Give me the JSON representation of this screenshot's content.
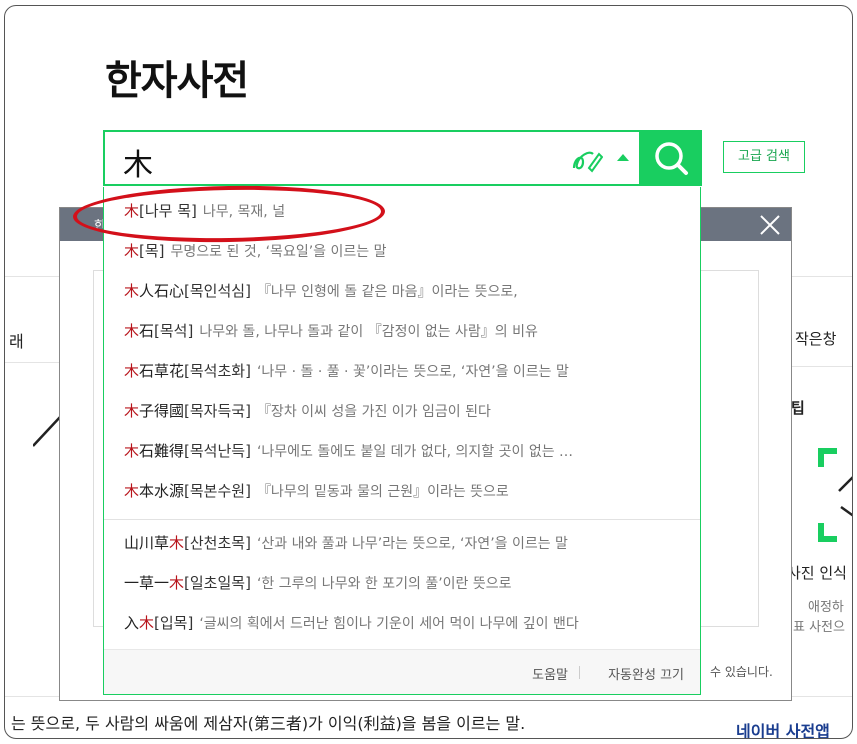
{
  "page_title": "한자사전",
  "search": {
    "value": "木",
    "advanced_label": "고급 검색"
  },
  "background": {
    "header_char": "한",
    "left_char": "래",
    "right_small_window": "작은창",
    "right_tip": "팁",
    "right_scan_label": "사진 인식",
    "right_sub1": "애정하",
    "right_sub2": "표 사전으",
    "footnote": "수 있습니다.",
    "bottom_sentence": "는 뜻으로, 두 사람의 싸움에 제삼자(第三者)가 이익(利益)을 봄을 이르는 말.",
    "bottom_right": "네이버 사전앱"
  },
  "autocomplete": {
    "items": [
      {
        "pre": "",
        "hl": "木",
        "post": "",
        "reading": "[나무 목]",
        "meaning": "나무, 목재, 널"
      },
      {
        "pre": "",
        "hl": "木",
        "post": "",
        "reading": "[목]",
        "meaning": "무명으로 된 것, ‘목요일’을 이르는 말"
      },
      {
        "pre": "",
        "hl": "木",
        "post": "人石心",
        "reading": "[목인석심]",
        "meaning": "『나무 인형에 돌 같은 마음』이라는 뜻으로,"
      },
      {
        "pre": "",
        "hl": "木",
        "post": "石",
        "reading": "[목석]",
        "meaning": "나무와 돌, 나무나 돌과 같이 『감정이 없는 사람』의 비유"
      },
      {
        "pre": "",
        "hl": "木",
        "post": "石草花",
        "reading": "[목석초화]",
        "meaning": "‘나무 · 돌 · 풀 · 꽃’이라는 뜻으로, ‘자연’을 이르는 말"
      },
      {
        "pre": "",
        "hl": "木",
        "post": "子得國",
        "reading": "[목자득국]",
        "meaning": "『장차 이씨 성을 가진 이가 임금이 된다"
      },
      {
        "pre": "",
        "hl": "木",
        "post": "石難得",
        "reading": "[목석난득]",
        "meaning": "‘나무에도 돌에도 붙일 데가 없다, 의지할 곳이 없는 …"
      },
      {
        "pre": "",
        "hl": "木",
        "post": "本水源",
        "reading": "[목본수원]",
        "meaning": "『나무의 밑동과 물의 근원』이라는 뜻으로"
      },
      {
        "pre": "山川草",
        "hl": "木",
        "post": "",
        "reading": "[산천초목]",
        "meaning": "‘산과 내와 풀과 나무’라는 뜻으로, ‘자연’을 이르는 말"
      },
      {
        "pre": "一草一",
        "hl": "木",
        "post": "",
        "reading": "[일초일목]",
        "meaning": "‘한 그루의 나무와 한 포기의 풀’이란 뜻으로"
      },
      {
        "pre": "入",
        "hl": "木",
        "post": "",
        "reading": "[입목]",
        "meaning": "‘글씨의 획에서 드러난 힘이나 기운이 세어 먹이 나무에 깊이 밴다"
      }
    ],
    "footer": {
      "help": "도움말",
      "off": "자동완성 끄기"
    }
  },
  "colors": {
    "accent": "#19ce60",
    "highlight": "#b8141b",
    "annotation": "#d3101a"
  }
}
